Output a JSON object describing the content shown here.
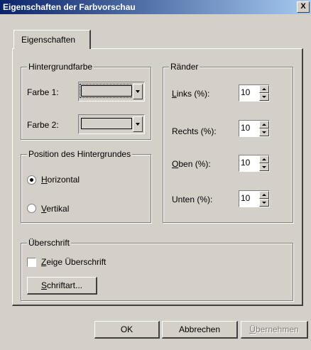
{
  "window": {
    "title": "Eigenschaften der Farbvorschau",
    "close_glyph": "X"
  },
  "tab": {
    "label": "Eigenschaften"
  },
  "background_color": {
    "legend": "Hintergrundfarbe",
    "color1_label": "Farbe 1:",
    "color2_label": "Farbe 2:"
  },
  "position": {
    "legend": "Position des Hintergrundes",
    "options": [
      {
        "key": "H",
        "rest": "orizontal",
        "checked": true
      },
      {
        "key": "V",
        "rest": "ertikal",
        "checked": false
      }
    ]
  },
  "margins": {
    "legend": "Ränder",
    "fields": [
      {
        "key": "L",
        "rest": "inks (%):",
        "value": "10"
      },
      {
        "key": "",
        "rest": "Rechts (%):",
        "value": "10"
      },
      {
        "key": "O",
        "rest": "ben (%):",
        "value": "10"
      },
      {
        "key": "",
        "rest": "Unten (%):",
        "value": "10"
      }
    ]
  },
  "heading": {
    "legend": "Überschrift",
    "show_key": "Z",
    "show_rest": "eige Überschrift",
    "show_checked": false,
    "font_key": "S",
    "font_rest": "chriftart..."
  },
  "footer": {
    "ok": "OK",
    "cancel": "Abbrechen",
    "apply_key": "Ü",
    "apply_rest": "bernehmen"
  }
}
